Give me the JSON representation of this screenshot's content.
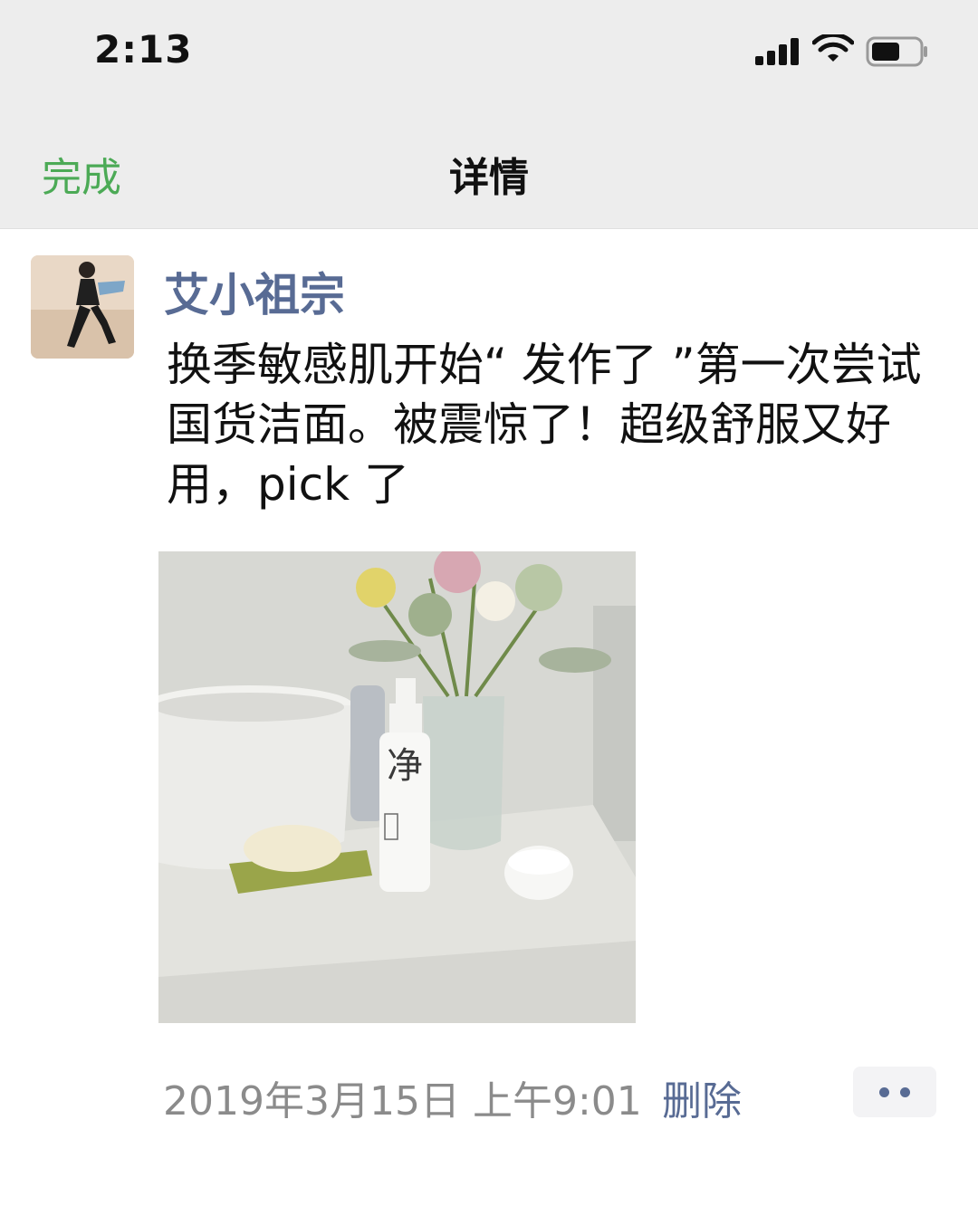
{
  "status_bar": {
    "time": "2:13",
    "signal_icon": "cellular-signal-icon",
    "wifi_icon": "wifi-icon",
    "battery_icon": "battery-icon"
  },
  "nav": {
    "done_label": "完成",
    "title": "详情",
    "accent_color": "#4caa56"
  },
  "post": {
    "username": "艾小祖宗",
    "text": "换季敏感肌开始“ 发作了 ”第一次尝试国货洁面。被震惊了！超级舒服又好用，pick 了",
    "image_icon": "bathroom-photo",
    "bottle_label": "净",
    "timestamp": "2019年3月15日 上午9:01",
    "delete_label": "删除",
    "more_icon": "more-dots-icon",
    "link_color": "#586b94"
  }
}
